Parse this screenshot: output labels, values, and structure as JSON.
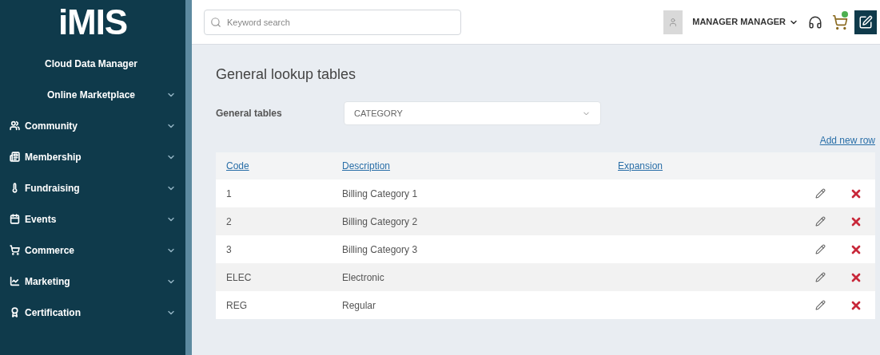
{
  "sidebar": {
    "logo": "iMIS",
    "items": [
      {
        "label": "Cloud Data Manager",
        "kind": "plain",
        "expandable": false
      },
      {
        "label": "Online Marketplace",
        "kind": "plain",
        "expandable": true
      },
      {
        "label": "Community",
        "kind": "icon",
        "expandable": true
      },
      {
        "label": "Membership",
        "kind": "icon",
        "expandable": true
      },
      {
        "label": "Fundraising",
        "kind": "icon",
        "expandable": true
      },
      {
        "label": "Events",
        "kind": "icon",
        "expandable": true
      },
      {
        "label": "Commerce",
        "kind": "icon",
        "expandable": true
      },
      {
        "label": "Marketing",
        "kind": "icon",
        "expandable": true
      },
      {
        "label": "Certification",
        "kind": "icon",
        "expandable": true
      }
    ]
  },
  "topbar": {
    "search": {
      "placeholder": "Keyword search"
    },
    "user": "MANAGER MANAGER"
  },
  "page": {
    "title": "General lookup tables",
    "filter": {
      "label": "General tables",
      "value": "CATEGORY"
    },
    "add_link": "Add new row",
    "table": {
      "columns": [
        "Code",
        "Description",
        "Expansion"
      ],
      "rows": [
        {
          "code": "1",
          "description": "Billing Category 1"
        },
        {
          "code": "2",
          "description": "Billing Category 2"
        },
        {
          "code": "3",
          "description": "Billing Category 3"
        },
        {
          "code": "ELEC",
          "description": "Electronic"
        },
        {
          "code": "REG",
          "description": "Regular"
        }
      ]
    }
  }
}
